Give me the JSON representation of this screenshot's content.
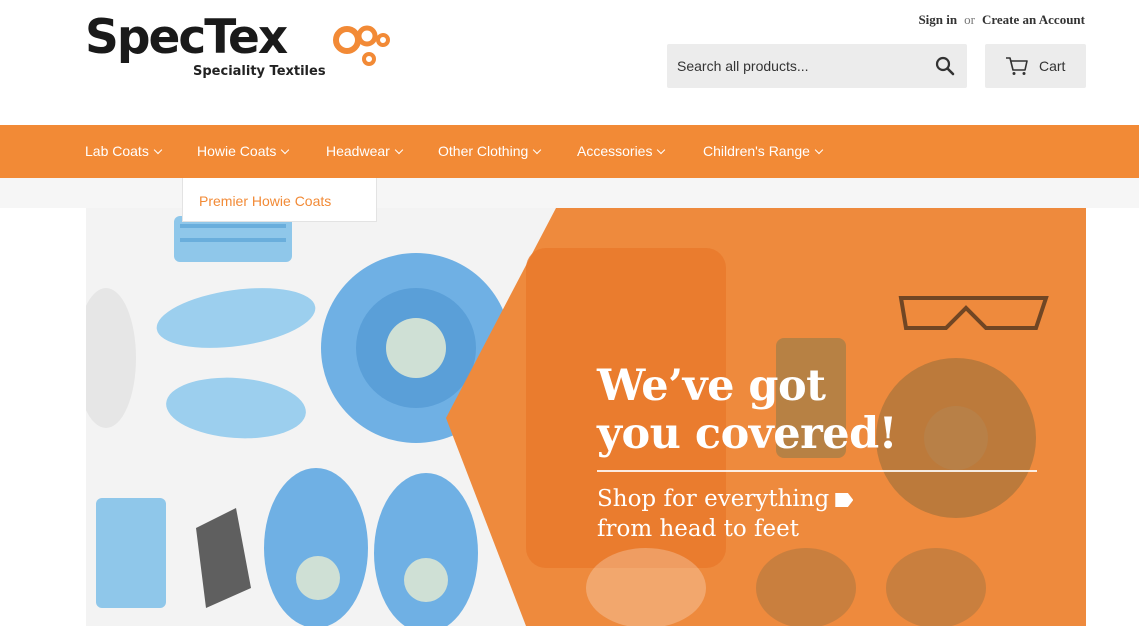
{
  "brand": {
    "name": "SpecTex",
    "tagline": "Speciality Textiles",
    "accent_color": "#f28a36"
  },
  "account": {
    "sign_in": "Sign in",
    "or": "or",
    "create_account": "Create an Account"
  },
  "search": {
    "placeholder": "Search all products...",
    "icon": "search-icon"
  },
  "cart": {
    "label": "Cart",
    "icon": "cart-icon"
  },
  "nav": {
    "items": [
      {
        "label": "Lab Coats"
      },
      {
        "label": "Howie Coats"
      },
      {
        "label": "Headwear"
      },
      {
        "label": "Other Clothing"
      },
      {
        "label": "Accessories"
      },
      {
        "label": "Children's Range"
      }
    ]
  },
  "dropdown": {
    "items": [
      {
        "label": "Premier Howie Coats"
      }
    ]
  },
  "hero": {
    "headline_line1": "We’ve got",
    "headline_line2": "you covered!",
    "sub_line1": "Shop for everything",
    "sub_line2": "from head to feet"
  }
}
